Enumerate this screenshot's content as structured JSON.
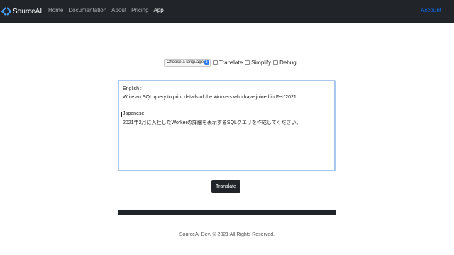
{
  "navbar": {
    "brand": "SourceAI",
    "links": [
      "Home",
      "Documentation",
      "About",
      "Pricing",
      "App"
    ],
    "active_link": "App",
    "account": "Account",
    "colors": {
      "background": "#212529",
      "link": "#a9acb0",
      "active": "#ffffff",
      "account": "#0d6efd"
    }
  },
  "options": {
    "language_select": {
      "value": "Choose a language"
    },
    "checkboxes": [
      {
        "label": "Translate",
        "checked": false
      },
      {
        "label": "Simplify",
        "checked": false
      },
      {
        "label": "Debug",
        "checked": false
      }
    ]
  },
  "editor": {
    "lines": [
      "English :",
      "Write an SQL query to print details of the Workers who have joined in Feb'2021",
      "Japanese:",
      "2021年2月に入社したWorkerの詳細を表示するSQLクエリを作成してください。"
    ]
  },
  "translate_button": "Translate",
  "footer": "SourceAI Dev. © 2021 All Rights Reserved."
}
